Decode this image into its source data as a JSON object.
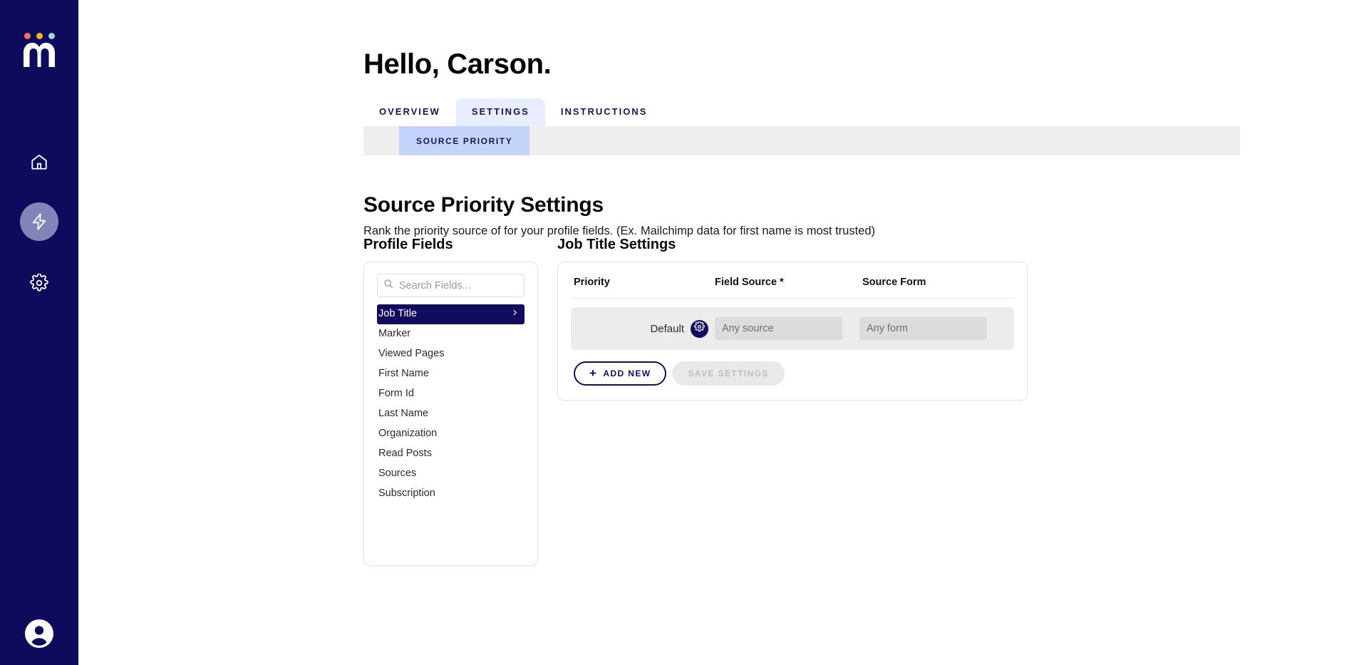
{
  "sidebar": {
    "logo": {
      "name": "mailchimp-style-m-logo",
      "dot_colors": [
        "#f2716b",
        "#f5b423",
        "#9fd9d2"
      ]
    },
    "items": [
      {
        "icon": "home-icon",
        "active": false
      },
      {
        "icon": "lightning-bolt-icon",
        "active": true
      },
      {
        "icon": "gear-icon",
        "active": false
      }
    ],
    "account": {
      "icon": "user-avatar-icon"
    },
    "background": "#0e0a5c",
    "active_pill": "#8284b8"
  },
  "header": {
    "greeting": "Hello, Carson."
  },
  "tabs": {
    "items": [
      {
        "label": "OVERVIEW",
        "active": false
      },
      {
        "label": "SETTINGS",
        "active": true
      },
      {
        "label": "INSTRUCTIONS",
        "active": false
      }
    ],
    "active_bg": "#e8eeff",
    "text_color": "#161457"
  },
  "subtabs": {
    "items": [
      {
        "label": "SOURCE PRIORITY",
        "active": true
      }
    ],
    "bar_bg": "#efefef",
    "active_bg": "#c5d4fb"
  },
  "page": {
    "title": "Source Priority Settings",
    "description": "Rank the priority source of for your profile fields. (Ex. Mailchimp data for first name is most trusted)"
  },
  "profile_fields": {
    "heading": "Profile Fields",
    "search": {
      "placeholder": "Search Fields...",
      "value": "",
      "icon": "search-icon"
    },
    "items": [
      {
        "label": "Job Title",
        "selected": true
      },
      {
        "label": "Marker",
        "selected": false
      },
      {
        "label": "Viewed Pages",
        "selected": false
      },
      {
        "label": "First Name",
        "selected": false
      },
      {
        "label": "Form Id",
        "selected": false
      },
      {
        "label": "Last Name",
        "selected": false
      },
      {
        "label": "Organization",
        "selected": false
      },
      {
        "label": "Read Posts",
        "selected": false
      },
      {
        "label": "Sources",
        "selected": false
      },
      {
        "label": "Subscription",
        "selected": false
      }
    ],
    "selected_bg": "#120c61",
    "chevron_icon": "chevron-right-icon"
  },
  "settings": {
    "heading": "Job Title Settings",
    "columns": {
      "priority": "Priority",
      "field_source": "Field Source *",
      "source_form": "Source Form"
    },
    "rows": [
      {
        "priority_label": "Default",
        "gear_icon": "gear-icon",
        "field_source_value": "Any source",
        "source_form_value": "Any form"
      }
    ],
    "buttons": {
      "add_new": "ADD NEW",
      "add_new_icon": "plus-icon",
      "save_settings": "SAVE SETTINGS",
      "save_disabled": true
    }
  }
}
